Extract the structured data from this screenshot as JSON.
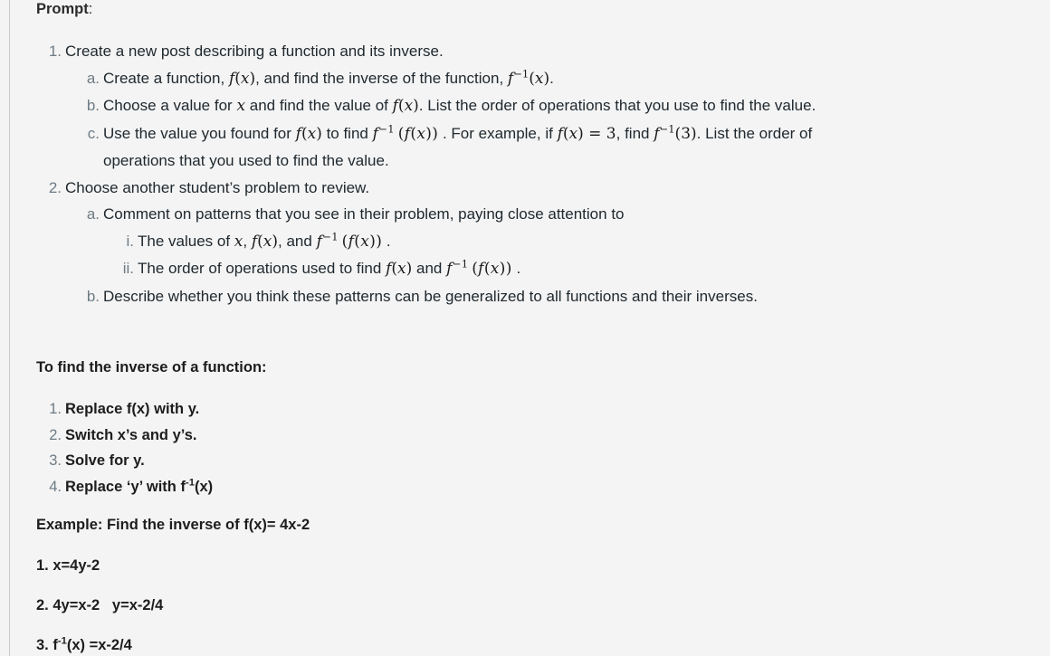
{
  "theme": {
    "background": "#f4f4f4",
    "text_color": "#20292f",
    "marker_color": "#6d7b85",
    "rule_color": "#c9cbd4"
  },
  "prompt": {
    "heading_bold": "Prompt",
    "heading_colon": ":",
    "items": [
      {
        "marker": "1.",
        "text": "Create a new post describing a function and its inverse.",
        "sub": [
          {
            "marker": "a.",
            "text_before": "Create a function,",
            "math_1": "f(x)",
            "text_mid": ", and find the inverse of the function,",
            "math_2": "f−1(x)",
            "text_after": "."
          },
          {
            "marker": "b.",
            "text_before": "Choose a value for",
            "math_1": "x",
            "text_mid": "and find the value of",
            "math_2": "f(x)",
            "text_after": ". List the order of operations that you use to find the value."
          },
          {
            "marker": "c.",
            "text_before": "Use the value you found for",
            "math_1": "f(x)",
            "text_mid": "to find",
            "math_2": "f−1(f(x))",
            "text_mid_2": ". For example, if",
            "math_3": "f(x)=3",
            "text_mid_3": ", find",
            "math_4": "f−1(3)",
            "text_after": ". List the order of",
            "text_wrap": "operations that you used to find the value."
          }
        ]
      },
      {
        "marker": "2.",
        "text": "Choose another student’s problem to review.",
        "sub": [
          {
            "marker": "a.",
            "text_before": "Comment on patterns that you see in their problem, paying close attention to",
            "roman": [
              {
                "marker": "i.",
                "text_before": "The values of",
                "math_1": "x",
                "text_mid": ",",
                "math_2": "f(x)",
                "text_mid_2": ", and",
                "math_3": "f−1(f(x))",
                "text_after": "."
              },
              {
                "marker": "ii.",
                "text_before": "The order of operations used to find",
                "math_1": "f(x)",
                "text_mid": "and",
                "math_2": "f−1(f(x))",
                "text_after": "."
              }
            ]
          },
          {
            "marker": "b.",
            "text_before": "Describe whether you think these patterns can be generalized to all functions and their inverses."
          }
        ]
      }
    ]
  },
  "inverse_section": {
    "heading": "To find the inverse of a function:",
    "steps": [
      {
        "marker": "1.",
        "text": "Replace f(x) with y."
      },
      {
        "marker": "2.",
        "text": "Switch x’s and y’s."
      },
      {
        "marker": "3.",
        "text": "Solve for y."
      },
      {
        "marker": "4.",
        "text_before": "Replace ‘y’ with f",
        "sup": "-1",
        "text_after": "(x)"
      }
    ]
  },
  "example_section": {
    "heading": "Example: Find the inverse of f(x)= 4x-2",
    "step_1": "1. x=4y-2",
    "step_2": "2. 4y=x-2   y=x-2/4",
    "step_3_before": "3. f",
    "step_3_sup": "-1",
    "step_3_after": "(x) =x-2/4"
  }
}
